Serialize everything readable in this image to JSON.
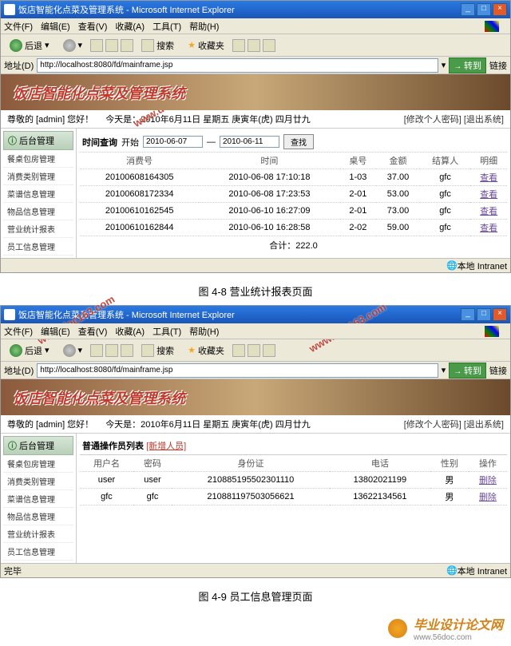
{
  "window": {
    "title": "饭店智能化点菜及管理系统 - Microsoft Internet Explorer",
    "btn_min": "_",
    "btn_max": "□",
    "btn_close": "×"
  },
  "menubar": {
    "items": [
      "文件(F)",
      "编辑(E)",
      "查看(V)",
      "收藏(A)",
      "工具(T)",
      "帮助(H)"
    ]
  },
  "toolbar": {
    "back": "后退",
    "search": "搜索",
    "favorites": "收藏夹"
  },
  "addrbar": {
    "label": "地址(D)",
    "url": "http://localhost:8080/fd/mainframe.jsp",
    "go": "转到",
    "links": "链接"
  },
  "banner": {
    "title": "饭店智能化点菜及管理系统"
  },
  "infobar": {
    "greeting": "尊敬的 [admin] 您好！",
    "date": "今天是：2010年6月11日 星期五 庚寅年(虎) 四月廿九",
    "pwd": "[修改个人密码]",
    "logout": "[退出系统]"
  },
  "sidebar": {
    "head": "后台管理",
    "items": [
      "餐桌包房管理",
      "消费类别管理",
      "菜谱信息管理",
      "物品信息管理",
      "营业统计报表",
      "员工信息管理"
    ]
  },
  "screen1": {
    "query": {
      "label": "时间查询",
      "start": "开始",
      "date1": "2010-06-07",
      "sep": "—",
      "date2": "2010-06-11",
      "btn": "查找"
    },
    "cols": [
      "消费号",
      "时间",
      "桌号",
      "金额",
      "结算人",
      "明细"
    ],
    "rows": [
      {
        "id": "20100608164305",
        "time": "2010-06-08 17:10:18",
        "table": "1-03",
        "amount": "37.00",
        "cashier": "gfc",
        "detail": "查看"
      },
      {
        "id": "20100608172334",
        "time": "2010-06-08 17:23:53",
        "table": "2-01",
        "amount": "53.00",
        "cashier": "gfc",
        "detail": "查看"
      },
      {
        "id": "20100610162545",
        "time": "2010-06-10 16:27:09",
        "table": "2-01",
        "amount": "73.00",
        "cashier": "gfc",
        "detail": "查看"
      },
      {
        "id": "20100610162844",
        "time": "2010-06-10 16:28:58",
        "table": "2-02",
        "amount": "59.00",
        "cashier": "gfc",
        "detail": "查看"
      }
    ],
    "total_label": "合计：",
    "total_value": "222.0"
  },
  "screen2": {
    "title": "普通操作员列表",
    "addlink": "[新增人员]",
    "cols": [
      "用户名",
      "密码",
      "身份证",
      "电话",
      "性别",
      "操作"
    ],
    "rows": [
      {
        "user": "user",
        "pwd": "user",
        "idc": "210885195502301110",
        "tel": "13802021199",
        "sex": "男",
        "op": "删除"
      },
      {
        "user": "gfc",
        "pwd": "gfc",
        "idc": "210881197503056621",
        "tel": "13622134561",
        "sex": "男",
        "op": "删除"
      }
    ]
  },
  "status": {
    "done": "完毕",
    "zone": "本地 Intranet"
  },
  "captions": {
    "c1": "图 4-8 营业统计报表页面",
    "c2": "图 4-9 员工信息管理页面"
  },
  "footer": {
    "t1": "毕业设计论文网",
    "t2": "www.56doc.com"
  },
  "watermark": "www.doc163.com"
}
